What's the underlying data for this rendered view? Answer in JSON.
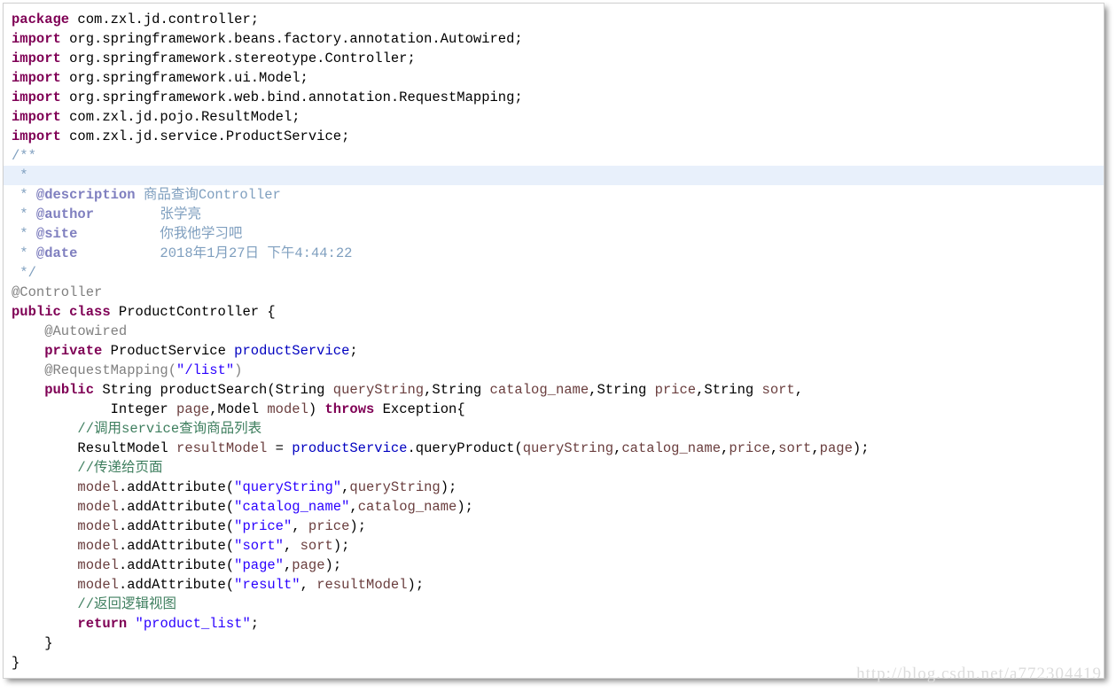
{
  "editor": {
    "language": "java",
    "file_kind": "java-source",
    "highlighted_line_index": 8,
    "colors": {
      "keyword": "#7f0055",
      "string": "#2a00ff",
      "comment": "#3f7f5f",
      "javadoc": "#7f9fbf",
      "javadoc_tag": "#7f7fbf",
      "annotation": "#808080",
      "field": "#0000c0",
      "local_variable": "#6a3e3e",
      "plain": "#000000",
      "line_highlight_bg": "#e8f0fb",
      "panel_bg": "#ffffff",
      "panel_border": "#cfcfcf",
      "watermark": "#dcdcdc"
    }
  },
  "code": {
    "lines": [
      {
        "n": 1,
        "tokens": [
          {
            "t": "kw",
            "v": "package"
          },
          {
            "t": "plain",
            "v": " com.zxl.jd.controller;"
          }
        ]
      },
      {
        "n": 2,
        "tokens": [
          {
            "t": "kw",
            "v": "import"
          },
          {
            "t": "plain",
            "v": " org.springframework.beans.factory.annotation.Autowired;"
          }
        ]
      },
      {
        "n": 3,
        "tokens": [
          {
            "t": "kw",
            "v": "import"
          },
          {
            "t": "plain",
            "v": " org.springframework.stereotype.Controller;"
          }
        ]
      },
      {
        "n": 4,
        "tokens": [
          {
            "t": "kw",
            "v": "import"
          },
          {
            "t": "plain",
            "v": " org.springframework.ui.Model;"
          }
        ]
      },
      {
        "n": 5,
        "tokens": [
          {
            "t": "kw",
            "v": "import"
          },
          {
            "t": "plain",
            "v": " org.springframework.web.bind.annotation.RequestMapping;"
          }
        ]
      },
      {
        "n": 6,
        "tokens": [
          {
            "t": "kw",
            "v": "import"
          },
          {
            "t": "plain",
            "v": " com.zxl.jd.pojo.ResultModel;"
          }
        ]
      },
      {
        "n": 7,
        "tokens": [
          {
            "t": "kw",
            "v": "import"
          },
          {
            "t": "plain",
            "v": " com.zxl.jd.service.ProductService;"
          }
        ]
      },
      {
        "n": 8,
        "tokens": [
          {
            "t": "jdoc",
            "v": "/**"
          }
        ]
      },
      {
        "n": 9,
        "hl": true,
        "tokens": [
          {
            "t": "jdoc",
            "v": " * "
          }
        ]
      },
      {
        "n": 10,
        "tokens": [
          {
            "t": "jdoc",
            "v": " * "
          },
          {
            "t": "jtag",
            "v": "@description"
          },
          {
            "t": "jtxt",
            "v": " 商品查询Controller"
          }
        ]
      },
      {
        "n": 11,
        "tokens": [
          {
            "t": "jdoc",
            "v": " * "
          },
          {
            "t": "jtag",
            "v": "@author"
          },
          {
            "t": "jtxt",
            "v": "        张学亮"
          }
        ]
      },
      {
        "n": 12,
        "tokens": [
          {
            "t": "jdoc",
            "v": " * "
          },
          {
            "t": "jtag",
            "v": "@site"
          },
          {
            "t": "jtxt",
            "v": "          你我他学习吧"
          }
        ]
      },
      {
        "n": 13,
        "tokens": [
          {
            "t": "jdoc",
            "v": " * "
          },
          {
            "t": "jtag",
            "v": "@date"
          },
          {
            "t": "jtxt",
            "v": "          2018年1月27日 下午4:44:22"
          }
        ]
      },
      {
        "n": 14,
        "tokens": [
          {
            "t": "jdoc",
            "v": " */"
          }
        ]
      },
      {
        "n": 15,
        "tokens": [
          {
            "t": "ann",
            "v": "@Controller"
          }
        ]
      },
      {
        "n": 16,
        "tokens": [
          {
            "t": "kw",
            "v": "public class"
          },
          {
            "t": "plain",
            "v": " ProductController {"
          }
        ]
      },
      {
        "n": 17,
        "tokens": [
          {
            "t": "ann",
            "v": "    @Autowired"
          }
        ]
      },
      {
        "n": 18,
        "tokens": [
          {
            "t": "plain",
            "v": "    "
          },
          {
            "t": "kw",
            "v": "private"
          },
          {
            "t": "plain",
            "v": " ProductService "
          },
          {
            "t": "fld",
            "v": "productService"
          },
          {
            "t": "plain",
            "v": ";"
          }
        ]
      },
      {
        "n": 19,
        "tokens": [
          {
            "t": "ann",
            "v": "    @RequestMapping("
          },
          {
            "t": "str",
            "v": "\"/list\""
          },
          {
            "t": "ann",
            "v": ")"
          }
        ]
      },
      {
        "n": 20,
        "tokens": [
          {
            "t": "plain",
            "v": "    "
          },
          {
            "t": "kw",
            "v": "public"
          },
          {
            "t": "plain",
            "v": " String productSearch(String "
          },
          {
            "t": "loc",
            "v": "queryString"
          },
          {
            "t": "plain",
            "v": ",String "
          },
          {
            "t": "loc",
            "v": "catalog_name"
          },
          {
            "t": "plain",
            "v": ",String "
          },
          {
            "t": "loc",
            "v": "price"
          },
          {
            "t": "plain",
            "v": ",String "
          },
          {
            "t": "loc",
            "v": "sort"
          },
          {
            "t": "plain",
            "v": ","
          }
        ]
      },
      {
        "n": 21,
        "tokens": [
          {
            "t": "plain",
            "v": "            Integer "
          },
          {
            "t": "loc",
            "v": "page"
          },
          {
            "t": "plain",
            "v": ",Model "
          },
          {
            "t": "loc",
            "v": "model"
          },
          {
            "t": "plain",
            "v": ") "
          },
          {
            "t": "kw",
            "v": "throws"
          },
          {
            "t": "plain",
            "v": " Exception{"
          }
        ]
      },
      {
        "n": 22,
        "tokens": [
          {
            "t": "plain",
            "v": "        "
          },
          {
            "t": "cmt",
            "v": "//调用service查询商品列表"
          }
        ]
      },
      {
        "n": 23,
        "tokens": [
          {
            "t": "plain",
            "v": "        ResultModel "
          },
          {
            "t": "loc",
            "v": "resultModel"
          },
          {
            "t": "plain",
            "v": " = "
          },
          {
            "t": "fld",
            "v": "productService"
          },
          {
            "t": "plain",
            "v": ".queryProduct("
          },
          {
            "t": "loc",
            "v": "queryString"
          },
          {
            "t": "plain",
            "v": ","
          },
          {
            "t": "loc",
            "v": "catalog_name"
          },
          {
            "t": "plain",
            "v": ","
          },
          {
            "t": "loc",
            "v": "price"
          },
          {
            "t": "plain",
            "v": ","
          },
          {
            "t": "loc",
            "v": "sort"
          },
          {
            "t": "plain",
            "v": ","
          },
          {
            "t": "loc",
            "v": "page"
          },
          {
            "t": "plain",
            "v": ");"
          }
        ]
      },
      {
        "n": 24,
        "tokens": [
          {
            "t": "plain",
            "v": "        "
          },
          {
            "t": "cmt",
            "v": "//传递给页面"
          }
        ]
      },
      {
        "n": 25,
        "tokens": [
          {
            "t": "plain",
            "v": "        "
          },
          {
            "t": "loc",
            "v": "model"
          },
          {
            "t": "plain",
            "v": ".addAttribute("
          },
          {
            "t": "str",
            "v": "\"queryString\""
          },
          {
            "t": "plain",
            "v": ","
          },
          {
            "t": "loc",
            "v": "queryString"
          },
          {
            "t": "plain",
            "v": ");"
          }
        ]
      },
      {
        "n": 26,
        "tokens": [
          {
            "t": "plain",
            "v": "        "
          },
          {
            "t": "loc",
            "v": "model"
          },
          {
            "t": "plain",
            "v": ".addAttribute("
          },
          {
            "t": "str",
            "v": "\"catalog_name\""
          },
          {
            "t": "plain",
            "v": ","
          },
          {
            "t": "loc",
            "v": "catalog_name"
          },
          {
            "t": "plain",
            "v": ");"
          }
        ]
      },
      {
        "n": 27,
        "tokens": [
          {
            "t": "plain",
            "v": "        "
          },
          {
            "t": "loc",
            "v": "model"
          },
          {
            "t": "plain",
            "v": ".addAttribute("
          },
          {
            "t": "str",
            "v": "\"price\""
          },
          {
            "t": "plain",
            "v": ", "
          },
          {
            "t": "loc",
            "v": "price"
          },
          {
            "t": "plain",
            "v": ");"
          }
        ]
      },
      {
        "n": 28,
        "tokens": [
          {
            "t": "plain",
            "v": "        "
          },
          {
            "t": "loc",
            "v": "model"
          },
          {
            "t": "plain",
            "v": ".addAttribute("
          },
          {
            "t": "str",
            "v": "\"sort\""
          },
          {
            "t": "plain",
            "v": ", "
          },
          {
            "t": "loc",
            "v": "sort"
          },
          {
            "t": "plain",
            "v": ");"
          }
        ]
      },
      {
        "n": 29,
        "tokens": [
          {
            "t": "plain",
            "v": "        "
          },
          {
            "t": "loc",
            "v": "model"
          },
          {
            "t": "plain",
            "v": ".addAttribute("
          },
          {
            "t": "str",
            "v": "\"page\""
          },
          {
            "t": "plain",
            "v": ","
          },
          {
            "t": "loc",
            "v": "page"
          },
          {
            "t": "plain",
            "v": ");"
          }
        ]
      },
      {
        "n": 30,
        "tokens": [
          {
            "t": "plain",
            "v": "        "
          },
          {
            "t": "loc",
            "v": "model"
          },
          {
            "t": "plain",
            "v": ".addAttribute("
          },
          {
            "t": "str",
            "v": "\"result\""
          },
          {
            "t": "plain",
            "v": ", "
          },
          {
            "t": "loc",
            "v": "resultModel"
          },
          {
            "t": "plain",
            "v": ");"
          }
        ]
      },
      {
        "n": 31,
        "tokens": [
          {
            "t": "plain",
            "v": "        "
          },
          {
            "t": "cmt",
            "v": "//返回逻辑视图"
          }
        ]
      },
      {
        "n": 32,
        "tokens": [
          {
            "t": "plain",
            "v": "        "
          },
          {
            "t": "kw",
            "v": "return"
          },
          {
            "t": "plain",
            "v": " "
          },
          {
            "t": "str",
            "v": "\"product_list\""
          },
          {
            "t": "plain",
            "v": ";"
          }
        ]
      },
      {
        "n": 33,
        "tokens": [
          {
            "t": "plain",
            "v": "    }"
          }
        ]
      },
      {
        "n": 34,
        "tokens": [
          {
            "t": "plain",
            "v": "}"
          }
        ]
      }
    ]
  },
  "watermark": {
    "text": "http://blog.csdn.net/a772304419"
  }
}
